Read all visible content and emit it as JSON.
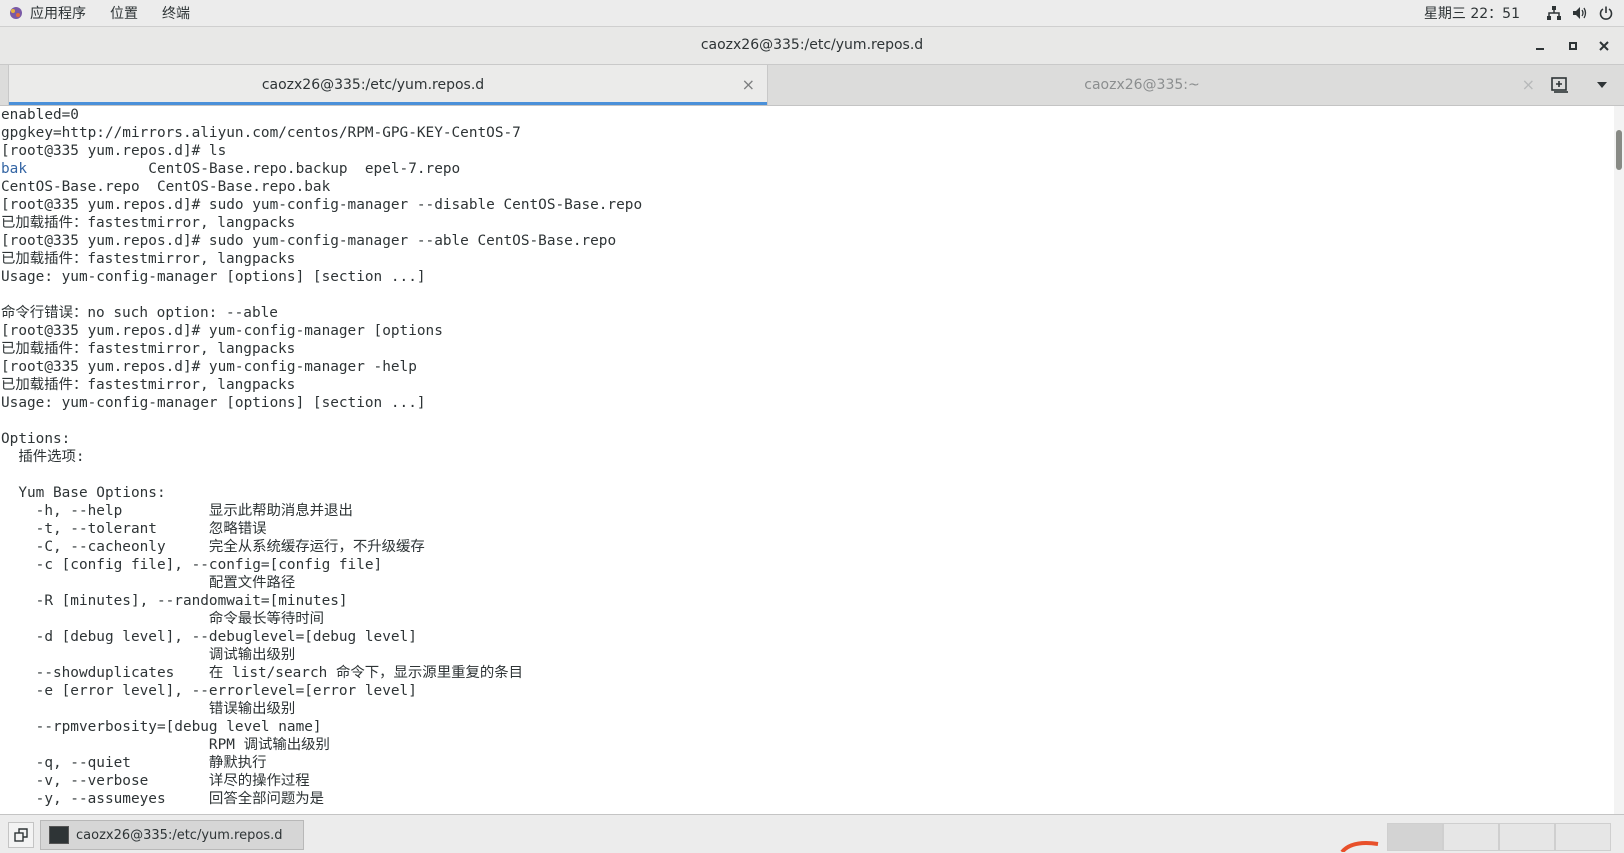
{
  "top_panel": {
    "menu": [
      "应用程序",
      "位置",
      "终端"
    ],
    "clock": "星期三 22：51",
    "icons": [
      "applications-icon",
      "network-icon",
      "volume-icon",
      "power-icon"
    ]
  },
  "window": {
    "title": "caozx26@335:/etc/yum.repos.d",
    "buttons": [
      "minimize-icon",
      "maximize-icon",
      "close-icon"
    ]
  },
  "tabs": [
    {
      "label": "caozx26@335:/etc/yum.repos.d",
      "active": true,
      "close": "×"
    },
    {
      "label": "caozx26@335:~",
      "active": false,
      "close": "×"
    }
  ],
  "terminal": {
    "lines": [
      "enabled=0",
      "gpgkey=http://mirrors.aliyun.com/centos/RPM-GPG-KEY-CentOS-7",
      "[root@335 yum.repos.d]# ls",
      "__LS1__",
      "CentOS-Base.repo  CentOS-Base.repo.bak",
      "[root@335 yum.repos.d]# sudo yum-config-manager --disable CentOS-Base.repo",
      "已加载插件：fastestmirror, langpacks",
      "[root@335 yum.repos.d]# sudo yum-config-manager --able CentOS-Base.repo",
      "已加载插件：fastestmirror, langpacks",
      "Usage: yum-config-manager [options] [section ...]",
      "",
      "命令行错误：no such option: --able",
      "[root@335 yum.repos.d]# yum-config-manager [options",
      "已加载插件：fastestmirror, langpacks",
      "[root@335 yum.repos.d]# yum-config-manager -help",
      "已加载插件：fastestmirror, langpacks",
      "Usage: yum-config-manager [options] [section ...]",
      "",
      "Options:",
      "  插件选项:",
      "",
      "  Yum Base Options:",
      "    -h, --help          显示此帮助消息并退出",
      "    -t, --tolerant      忽略错误",
      "    -C, --cacheonly     完全从系统缓存运行，不升级缓存",
      "    -c [config file], --config=[config file]",
      "                        配置文件路径",
      "    -R [minutes], --randomwait=[minutes]",
      "                        命令最长等待时间",
      "    -d [debug level], --debuglevel=[debug level]",
      "                        调试输出级别",
      "    --showduplicates    在 list/search 命令下，显示源里重复的条目",
      "    -e [error level], --errorlevel=[error level]",
      "                        错误输出级别",
      "    --rpmverbosity=[debug level name]",
      "                        RPM 调试输出级别",
      "    -q, --quiet         静默执行",
      "    -v, --verbose       详尽的操作过程",
      "    -y, --assumeyes     回答全部问题为是"
    ],
    "ls_dir": "bak",
    "ls_rest": "              CentOS-Base.repo.backup  epel-7.repo",
    "colors": {
      "fg": "#2e3436",
      "dir": "#3465a4",
      "bg": "#ffffff"
    }
  },
  "taskbar": {
    "task_label": "caozx26@335:/etc/yum.repos.d",
    "workspaces": 4
  }
}
